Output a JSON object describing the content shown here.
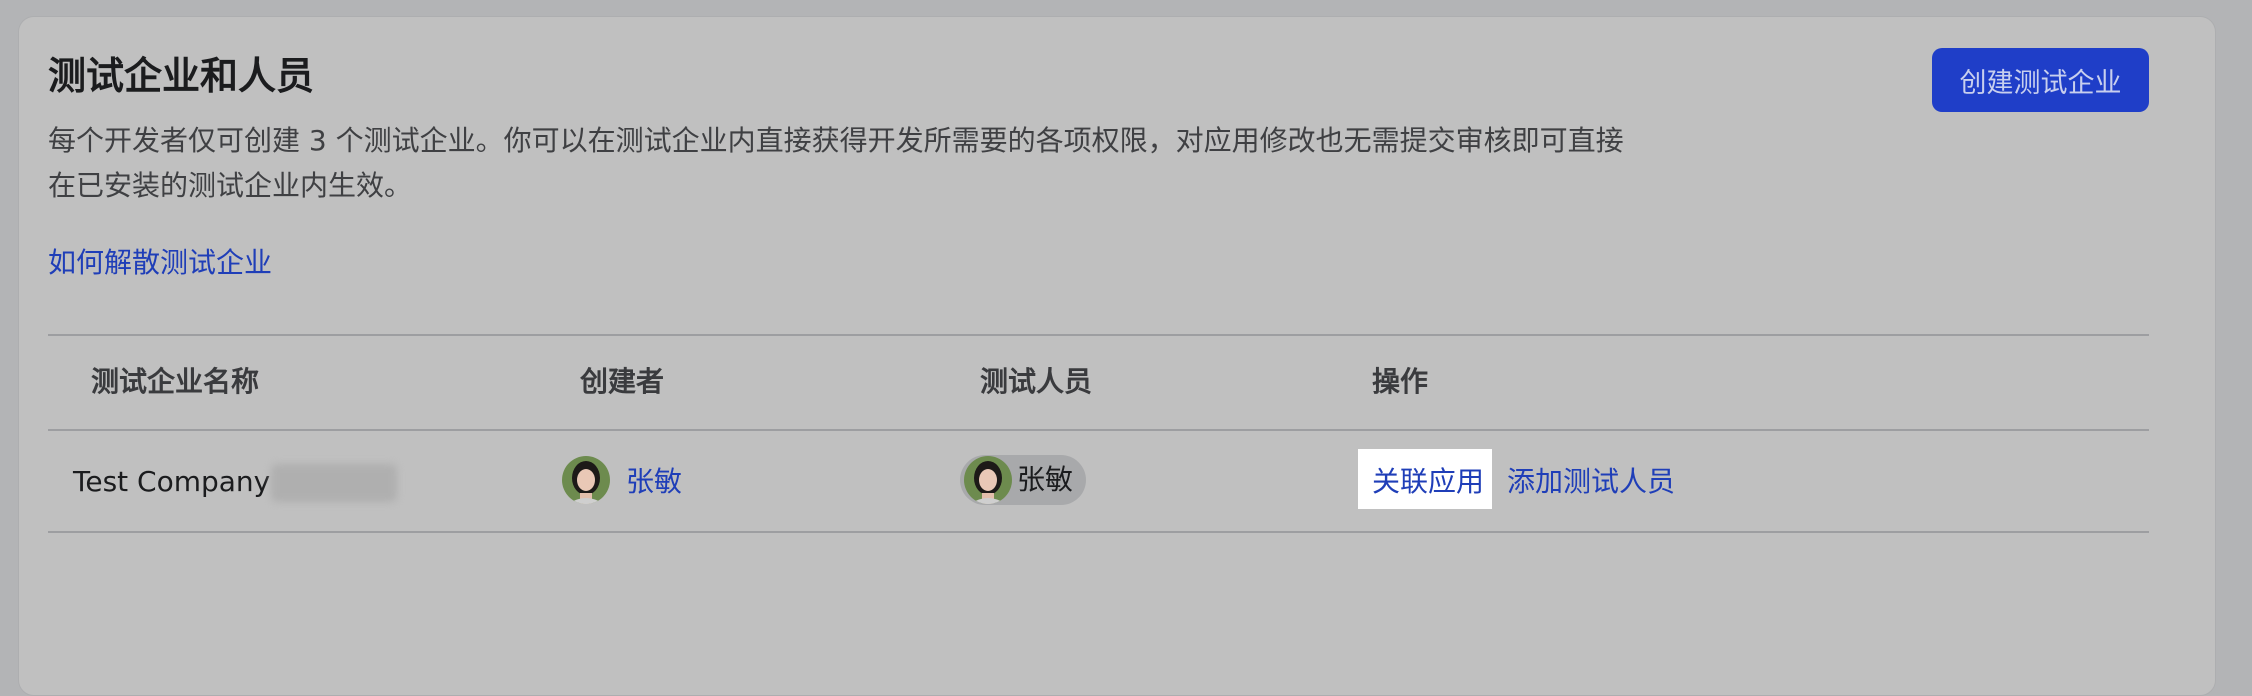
{
  "section": {
    "title": "测试企业和人员",
    "description_line1": "每个开发者仅可创建 3 个测试企业。你可以在测试企业内直接获得开发所需要的各项权限，对应用修改也无需提交审核即可直接",
    "description_line2": "在已安装的测试企业内生效。",
    "help_link": "如何解散测试企业",
    "create_button": "创建测试企业"
  },
  "table": {
    "columns": [
      "测试企业名称",
      "创建者",
      "测试人员",
      "操作"
    ],
    "rows": [
      {
        "company": "Test Company",
        "creator": "张敏",
        "tester": "张敏",
        "actions": [
          "关联应用",
          "添加测试人员"
        ]
      }
    ]
  },
  "colors": {
    "accent": "#1f3ec8",
    "link": "#1f3eb8",
    "highlight": "#ffffff"
  }
}
